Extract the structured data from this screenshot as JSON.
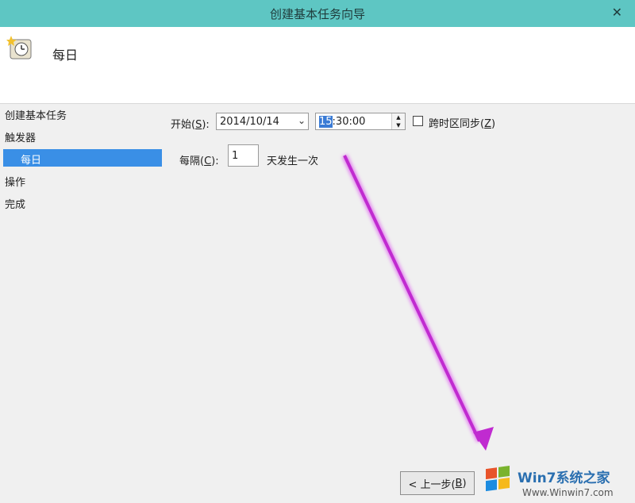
{
  "window": {
    "title": "创建基本任务向导",
    "close_glyph": "✕"
  },
  "header": {
    "title": "每日",
    "icon": "scheduler-clock-icon"
  },
  "nav": {
    "items": [
      {
        "label": "创建基本任务"
      },
      {
        "label": "触发器"
      },
      {
        "label": "每日",
        "selected": true
      },
      {
        "label": "操作"
      },
      {
        "label": "完成"
      }
    ]
  },
  "form": {
    "start_label": "开始(",
    "start_key": "S",
    "start_suffix": "):",
    "date_value": "2014/10/14",
    "time_hour": "15",
    "time_rest": ":30:00",
    "sync_label": "跨时区同步(",
    "sync_key": "Z",
    "sync_suffix": ")",
    "sync_checked": false,
    "recur_label": "每隔(",
    "recur_key": "C",
    "recur_suffix": "):",
    "recur_value": "1",
    "recur_unit": "天发生一次"
  },
  "footer": {
    "back_prefix": "< 上一步(",
    "back_key": "B",
    "back_suffix": ")"
  },
  "watermark": {
    "brand": "Win7系统之家",
    "url": "Www.Winwin7.com"
  },
  "colors": {
    "titlebar": "#5ec6c3",
    "selected": "#3a8fe6",
    "arrow": "#c02bd0"
  }
}
